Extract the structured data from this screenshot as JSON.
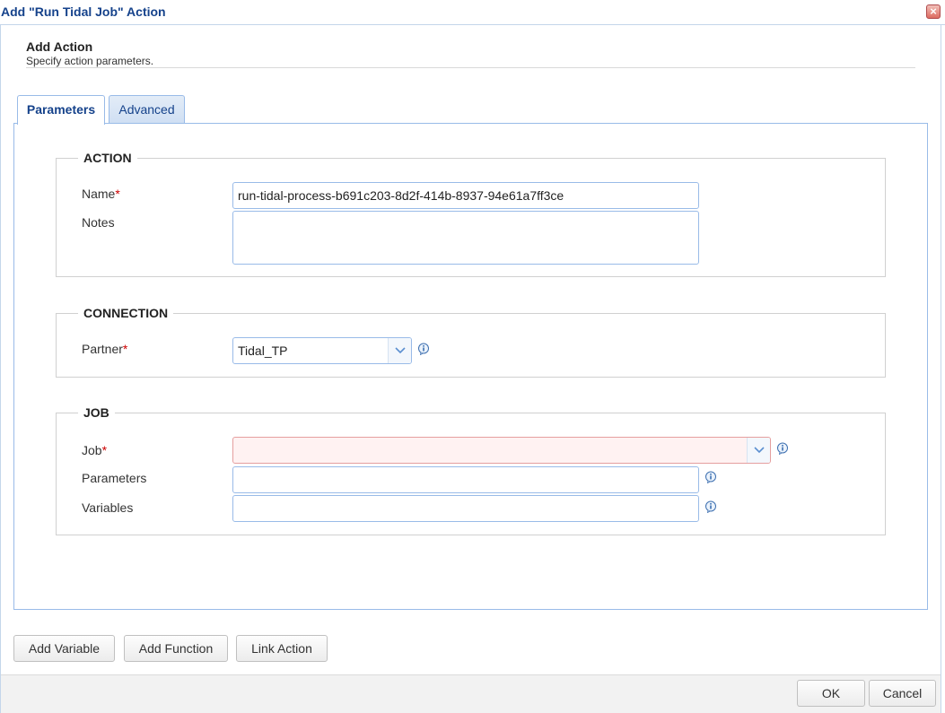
{
  "window": {
    "title": "Add \"Run Tidal Job\" Action",
    "close_glyph": "×"
  },
  "header": {
    "title": "Add Action",
    "subtitle": "Specify action parameters."
  },
  "tabs": [
    {
      "label": "Parameters",
      "active": true
    },
    {
      "label": "Advanced",
      "active": false
    }
  ],
  "sections": {
    "action": {
      "legend": "ACTION",
      "name_label": "Name",
      "name_value": "run-tidal-process-b691c203-8d2f-414b-8937-94e61a7ff3ce",
      "notes_label": "Notes",
      "notes_value": ""
    },
    "connection": {
      "legend": "CONNECTION",
      "partner_label": "Partner",
      "partner_value": "Tidal_TP"
    },
    "job": {
      "legend": "JOB",
      "job_label": "Job",
      "job_value": "",
      "parameters_label": "Parameters",
      "parameters_value": "",
      "variables_label": "Variables",
      "variables_value": ""
    }
  },
  "required_marker": "*",
  "buttons": {
    "add_variable": "Add Variable",
    "add_function": "Add Function",
    "link_action": "Link Action",
    "ok": "OK",
    "cancel": "Cancel"
  },
  "colors": {
    "title_text": "#15428b",
    "border_blue": "#99bbe8",
    "required": "#cc0000",
    "invalid_bg": "#fff2f2",
    "invalid_border": "#e59f9f",
    "info_icon": "#3d6fb0"
  },
  "icons": {
    "close": "close-icon",
    "combo": "chevron-down-icon",
    "info": "info-icon"
  }
}
